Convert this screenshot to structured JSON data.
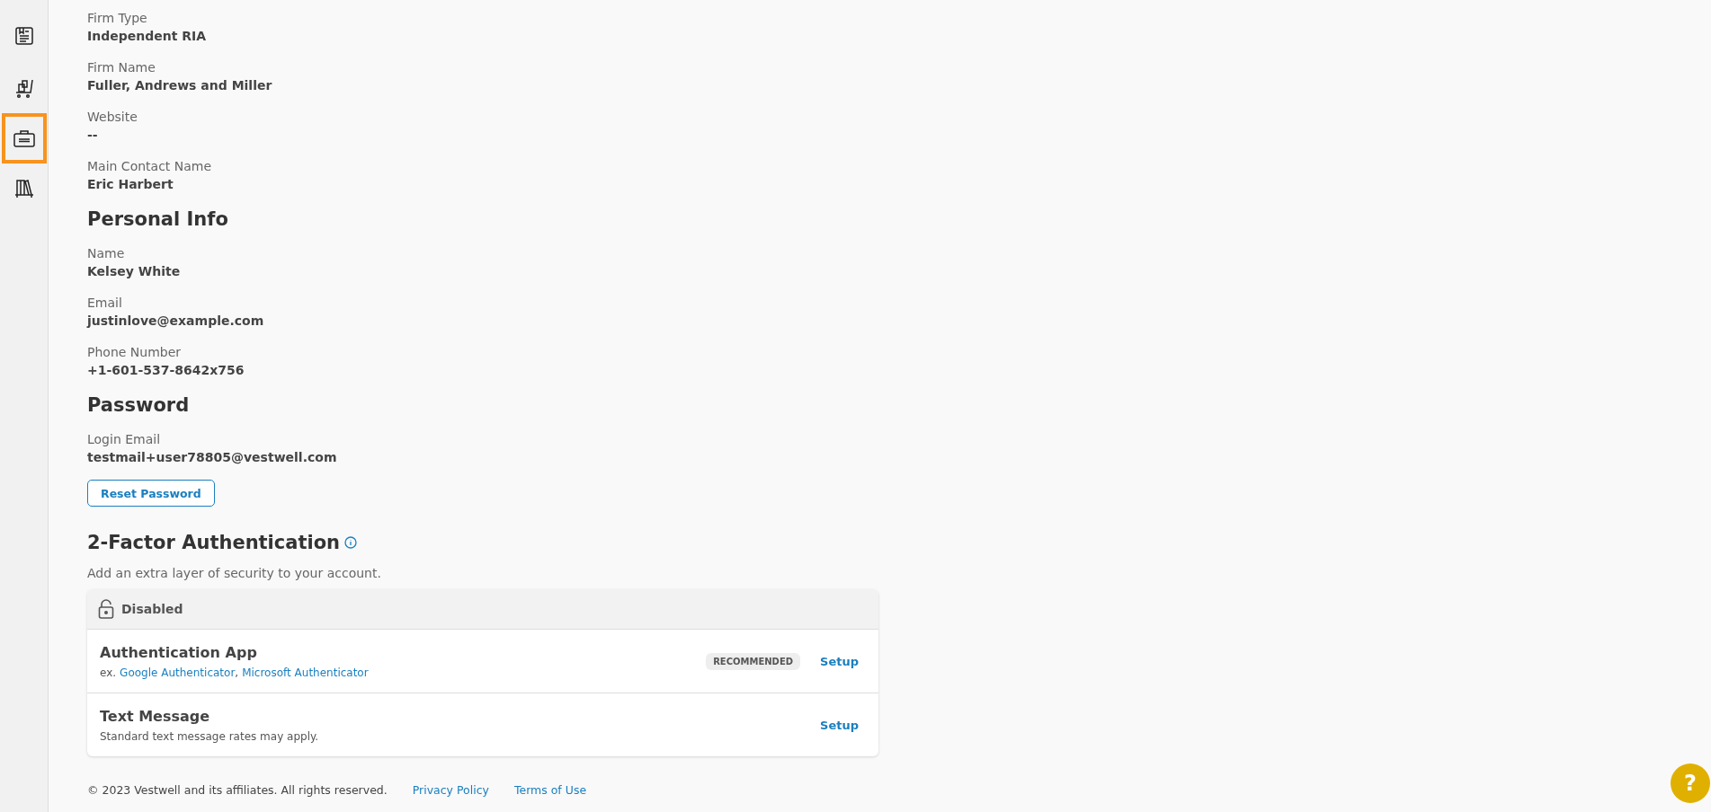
{
  "sidebar": {
    "items": [
      {
        "kind": "document",
        "selected": false
      },
      {
        "kind": "cart",
        "selected": false
      },
      {
        "kind": "briefcase",
        "selected": true
      },
      {
        "kind": "books",
        "selected": false
      }
    ]
  },
  "sections": [
    {
      "fields": [
        {
          "label": "Firm Type",
          "value": "Independent RIA"
        },
        {
          "label": "Firm Name",
          "value": "Fuller, Andrews and Miller"
        },
        {
          "label": "Website",
          "value": "--"
        },
        {
          "label": "Main Contact Name",
          "value": "Eric Harbert"
        }
      ]
    },
    {
      "heading": "Personal Info",
      "fields": [
        {
          "label": "Name",
          "value": "Kelsey White"
        },
        {
          "label": "Email",
          "value": "justinlove@example.com"
        },
        {
          "label": "Phone Number",
          "value": "+1-601-537-8642x756"
        }
      ]
    },
    {
      "heading": "Password",
      "fields": [
        {
          "label": "Login Email",
          "value": "testmail+user78805@vestwell.com"
        }
      ],
      "button": "Reset Password"
    }
  ],
  "two_factor": {
    "heading": "2-Factor Authentication",
    "description": "Add an extra layer of security to your account.",
    "status": "Disabled",
    "methods": [
      {
        "title": "Authentication App",
        "prefix": "ex.",
        "separator": ",",
        "links": [
          "Google Authenticator",
          "Microsoft Authenticator"
        ],
        "badge": "RECOMMENDED",
        "action": "Setup"
      },
      {
        "title": "Text Message",
        "note": "Standard text message rates may apply.",
        "action": "Setup"
      }
    ]
  },
  "footer": {
    "copyright": "© 2023 Vestwell and its affiliates. All rights reserved.",
    "links": [
      "Privacy Policy",
      "Terms of Use"
    ]
  },
  "help_button": "?"
}
